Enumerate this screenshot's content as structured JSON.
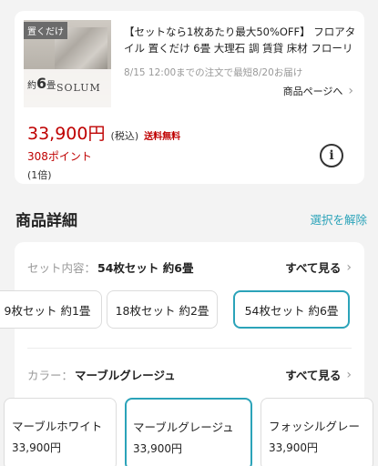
{
  "product": {
    "thumb_tag": "置くだけ",
    "thumb_count_prefix": "約",
    "thumb_count_number": "6",
    "thumb_count_suffix": "畳",
    "thumb_brand": "SOLUM",
    "title": "【セットなら1枚あたり最大50%OFF】 フロアタイル 置くだけ 6畳 大理石 調 賃貸 床材 フローリン…",
    "delivery": "8/15 12:00までの注文で最短8/20お届け",
    "detail_link": "商品ページへ",
    "price": "33,900円",
    "price_tax": "(税込)",
    "free_shipping": "送料無料",
    "points": "308ポイント",
    "multiplier": "(1倍)",
    "info_icon_glyph": "i"
  },
  "details": {
    "title": "商品詳細",
    "deselect": "選択を解除"
  },
  "set_option": {
    "label": "セット内容：",
    "value": "54枚セット 約6畳",
    "see_all": "すべて見る",
    "chips": [
      {
        "label": "9枚セット 約1畳"
      },
      {
        "label": "18枚セット 約2畳"
      },
      {
        "label": "54枚セット 約6畳"
      }
    ]
  },
  "color_option": {
    "label": "カラー：",
    "value": "マーブルグレージュ",
    "see_all": "すべて見る",
    "cards": [
      {
        "name": "マーブルホワイト",
        "price": "33,900円"
      },
      {
        "name": "マーブルグレージュ",
        "price": "33,900円"
      },
      {
        "name": "フォッシルグレー",
        "price": "33,900円"
      }
    ]
  },
  "colors": {
    "price_red": "#bf0000",
    "accent_teal": "#2ba3b9"
  },
  "icons": {
    "chevron": "chevron-right-icon",
    "info": "info-icon"
  }
}
